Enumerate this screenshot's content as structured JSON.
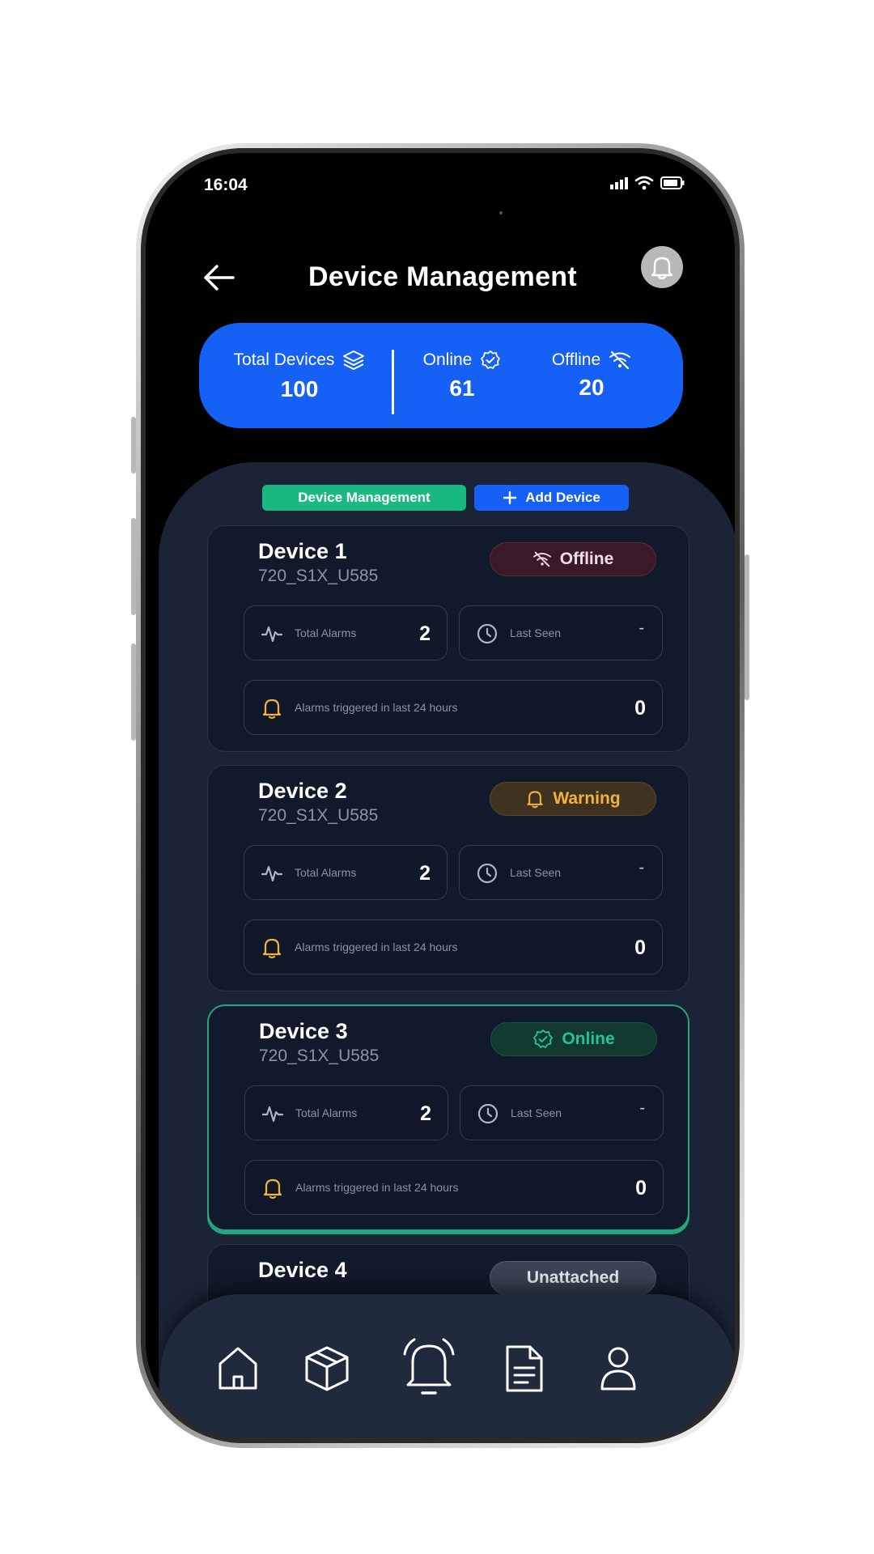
{
  "status_bar": {
    "time": "16:04"
  },
  "header": {
    "title": "Device Management"
  },
  "summary": {
    "total_label": "Total Devices",
    "total_value": "100",
    "online_label": "Online",
    "online_value": "61",
    "offline_label": "Offline",
    "offline_value": "20"
  },
  "tabs": {
    "device_management": "Device Management",
    "add_device": "Add Device"
  },
  "devices": [
    {
      "name": "Device 1",
      "id": "720_S1X_U585",
      "status": "Offline",
      "total_alarms_label": "Total Alarms",
      "total_alarms": "2",
      "last_seen_label": "Last Seen",
      "last_seen": "-",
      "alarms_24h_label": "Alarms triggered in last 24 hours",
      "alarms_24h": "0"
    },
    {
      "name": "Device 2",
      "id": "720_S1X_U585",
      "status": "Warning",
      "total_alarms_label": "Total Alarms",
      "total_alarms": "2",
      "last_seen_label": "Last Seen",
      "last_seen": "-",
      "alarms_24h_label": "Alarms triggered in last 24 hours",
      "alarms_24h": "0"
    },
    {
      "name": "Device 3",
      "id": "720_S1X_U585",
      "status": "Online",
      "total_alarms_label": "Total Alarms",
      "total_alarms": "2",
      "last_seen_label": "Last Seen",
      "last_seen": "-",
      "alarms_24h_label": "Alarms triggered in last 24 hours",
      "alarms_24h": "0"
    },
    {
      "name": "Device 4",
      "status": "Unattached"
    }
  ],
  "bottom_nav": {
    "items": [
      "home-icon",
      "package-icon",
      "alarm-bell-icon",
      "document-icon",
      "profile-icon"
    ],
    "active": "alarm-bell-icon"
  },
  "colors": {
    "accent_blue": "#1560f5",
    "accent_green": "#19b980",
    "warning": "#f0b43a",
    "online": "#27c38e",
    "panel": "#1b2436",
    "card": "#111a2b"
  }
}
